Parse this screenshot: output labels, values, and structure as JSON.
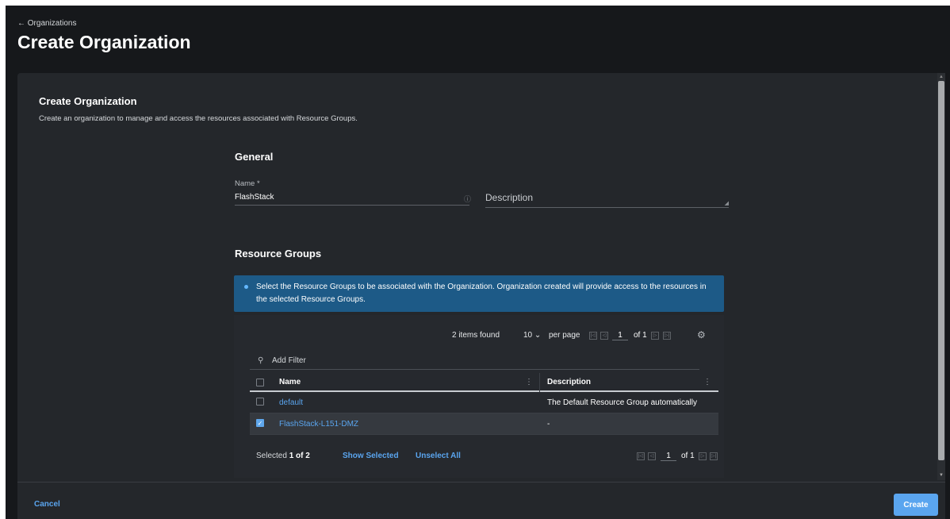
{
  "header": {
    "back_label": "← Organizations",
    "title": "Create Organization"
  },
  "form": {
    "section_title": "Create Organization",
    "section_subtitle": "Create an organization to manage and access the resources associated with Resource Groups.",
    "general_heading": "General",
    "name_label": "Name *",
    "name_value": "FlashStack",
    "name_hint": "ⓘ",
    "description_placeholder": "Description"
  },
  "resource_groups": {
    "heading": "Resource Groups",
    "info_banner": "Select the Resource Groups to be associated with the Organization. Organization created will provide access to the resources in the selected Resource Groups.",
    "items_found": "2 items found",
    "per_page_value": "10 ⌄",
    "per_page_label": "per page",
    "page_current": "1",
    "page_of": "of 1",
    "filter_placeholder": "Add Filter",
    "columns": [
      "Name",
      "Description"
    ],
    "rows": [
      {
        "name": "default",
        "description": "The Default Resource Group automatically",
        "checked": false
      },
      {
        "name": "FlashStack-L151-DMZ",
        "description": "-",
        "checked": true
      }
    ],
    "selected_prefix": "Selected",
    "selected_count": "1 of 2",
    "show_selected": "Show Selected",
    "unselect_all": "Unselect All",
    "bottom_page_current": "1",
    "bottom_page_of": "of 1"
  },
  "footer": {
    "cancel_label": "Cancel",
    "create_label": "Create"
  },
  "colors": {
    "accent": "#5aa5ef",
    "background": "#16181b",
    "panel": "#24272b",
    "banner": "#1d5a87"
  }
}
